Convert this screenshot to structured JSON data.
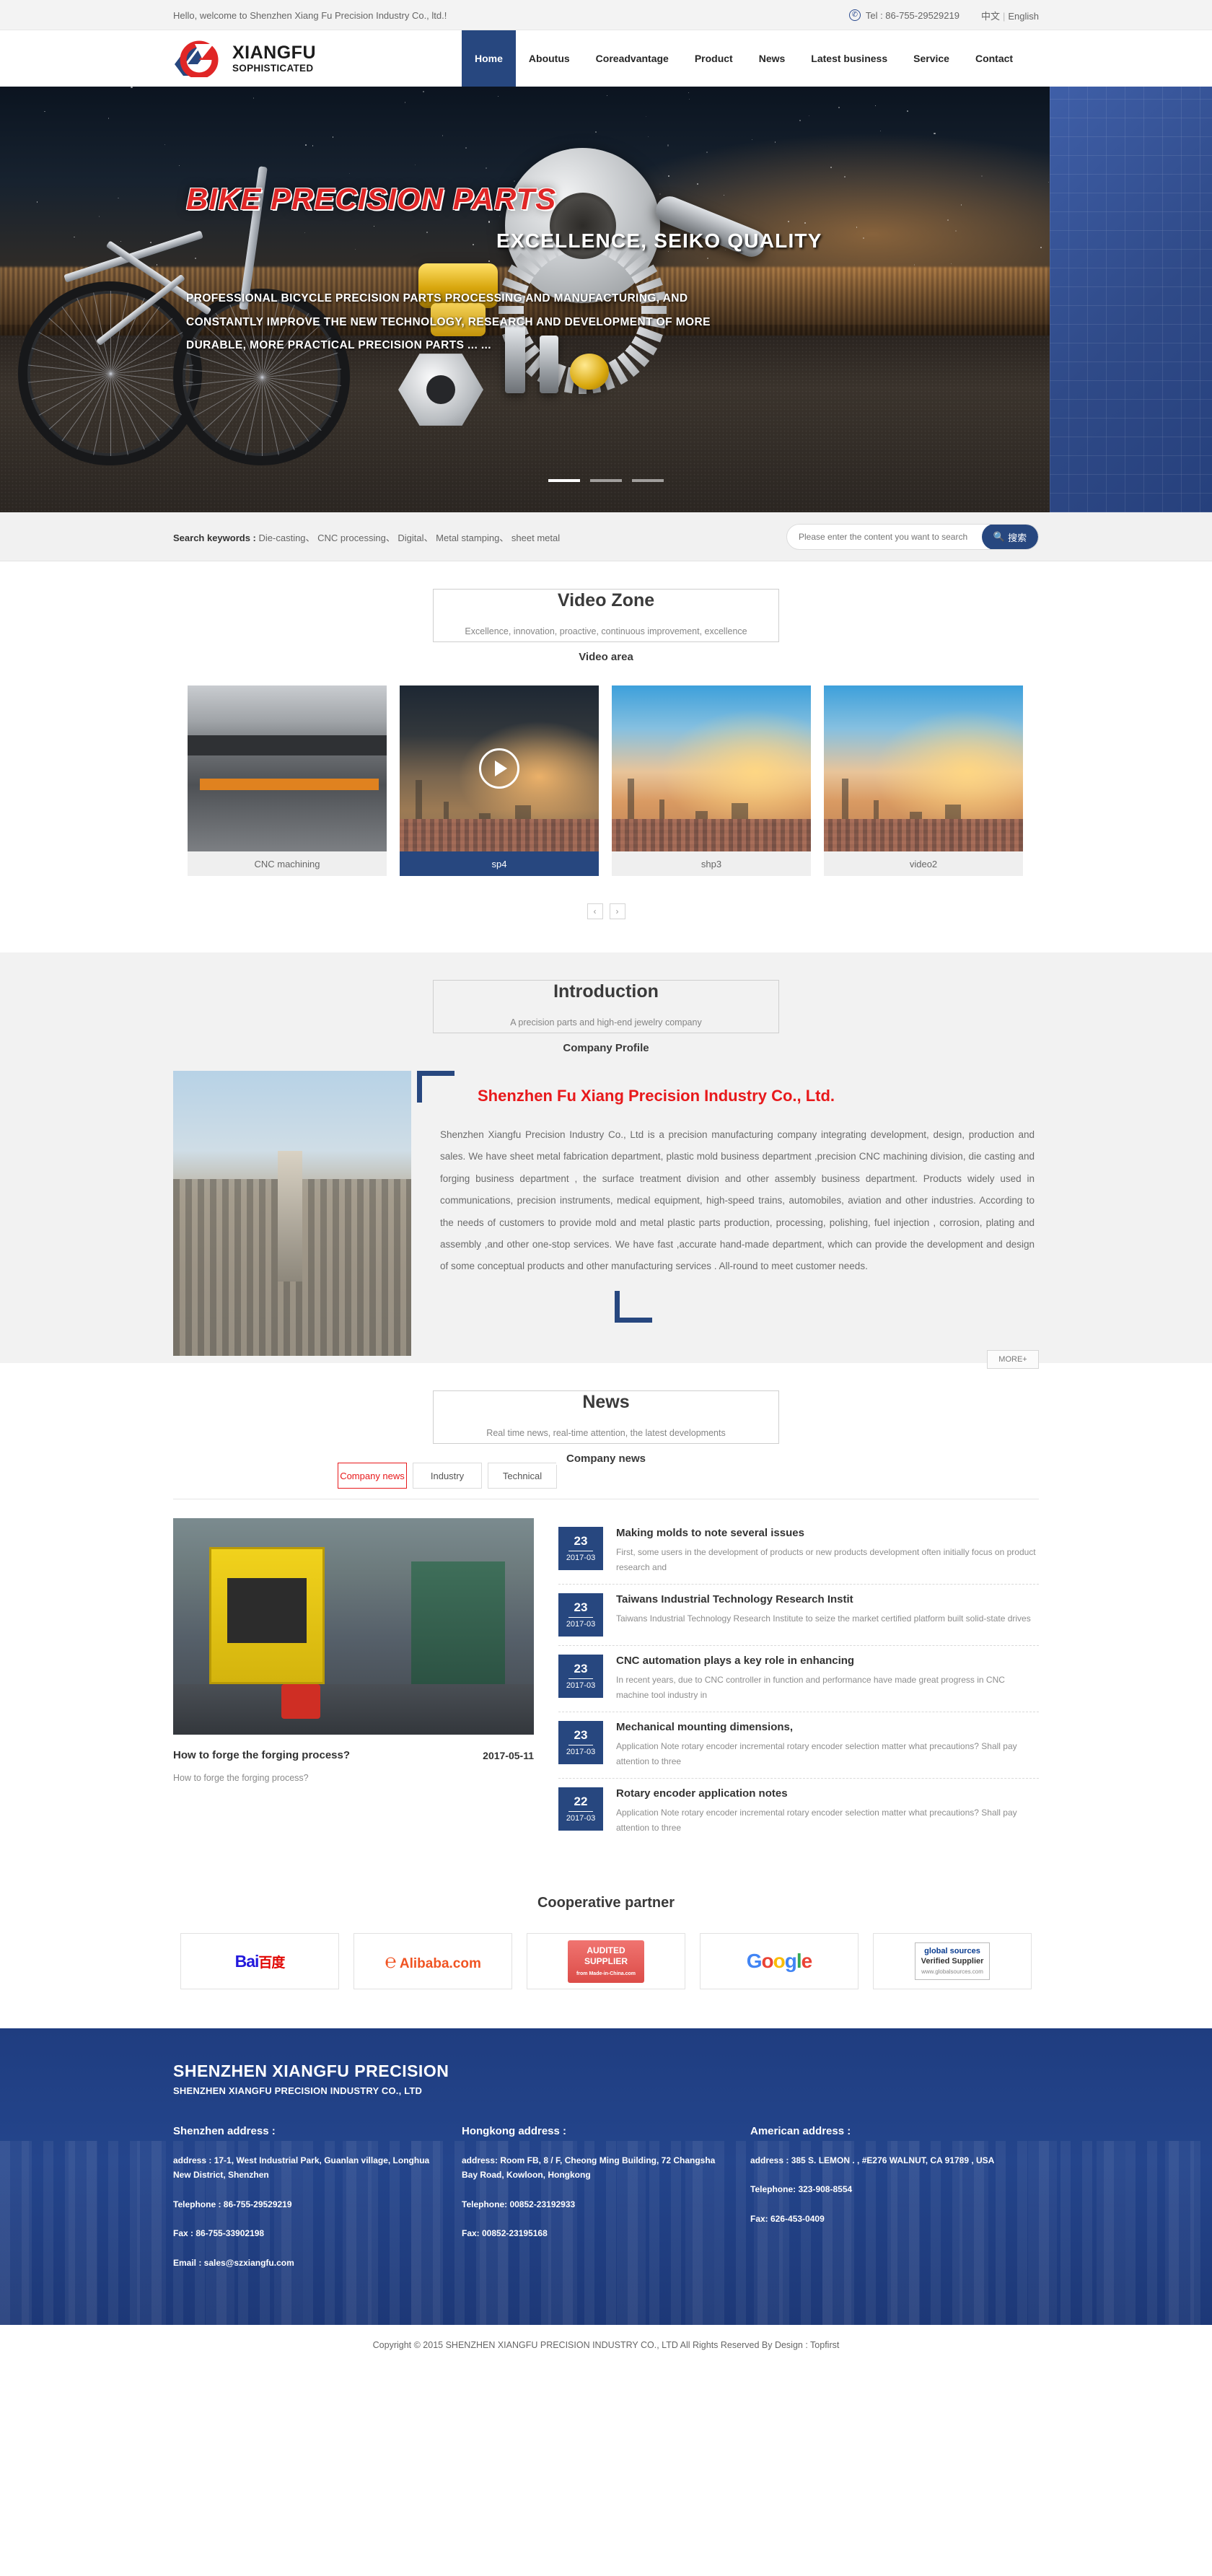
{
  "topbar": {
    "welcome": "Hello, welcome to Shenzhen Xiang Fu Precision Industry Co., ltd.!",
    "tel": "Tel : 86-755-29529219",
    "lang_cn": "中文",
    "lang_sep": "|",
    "lang_en": "English"
  },
  "header": {
    "logo_line1": "XIANGFU",
    "logo_line2": "SOPHISTICATED",
    "nav": [
      {
        "label": "Home",
        "active": true
      },
      {
        "label": "Aboutus",
        "active": false
      },
      {
        "label": "Coreadvantage",
        "active": false
      },
      {
        "label": "Product",
        "active": false
      },
      {
        "label": "News",
        "active": false
      },
      {
        "label": "Latest business",
        "active": false
      },
      {
        "label": "Service",
        "active": false
      },
      {
        "label": "Contact",
        "active": false
      }
    ]
  },
  "banner": {
    "title": "BIKE PRECISION PARTS",
    "subtitle": "EXCELLENCE, SEIKO QUALITY",
    "description": "PROFESSIONAL BICYCLE PRECISION PARTS PROCESSING AND MANUFACTURING, AND CONSTANTLY IMPROVE THE NEW TECHNOLOGY, RESEARCH AND DEVELOPMENT OF MORE DURABLE, MORE PRACTICAL PRECISION PARTS ... ...",
    "slides": 3,
    "active_slide": 1
  },
  "search": {
    "label": "Search keywords :",
    "keywords": "Die-casting、 CNC processing、 Digital、 Metal stamping、 sheet metal",
    "placeholder": "Please enter the content you want to search",
    "value": "",
    "button_label": "搜索"
  },
  "video_zone": {
    "title": "Video Zone",
    "subtitle": "Excellence, innovation, proactive, continuous improvement, excellence",
    "heading2": "Video area",
    "items": [
      {
        "label": "CNC machining",
        "active": false,
        "has_play": false
      },
      {
        "label": "sp4",
        "active": true,
        "has_play": true
      },
      {
        "label": "shp3",
        "active": false,
        "has_play": false
      },
      {
        "label": "video2",
        "active": false,
        "has_play": false
      }
    ],
    "prev_label": "‹",
    "next_label": "›"
  },
  "introduction": {
    "title": "Introduction",
    "subtitle": "A precision parts and high-end jewelry company",
    "heading2": "Company Profile",
    "company_name": "Shenzhen Fu Xiang Precision Industry Co., Ltd.",
    "body": "Shenzhen Xiangfu Precision Industry Co., Ltd is a precision manufacturing company integrating development, design, production and sales. We have sheet metal fabrication department, plastic mold business department ,precision CNC machining division, die casting and forging business department , the surface treatment division and other assembly business department. Products widely used in communications, precision instruments, medical equipment, high-speed trains, automobiles, aviation and other industries. According to the needs of customers to provide mold and metal plastic parts production, processing, polishing, fuel injection , corrosion, plating and assembly ,and other one-stop services. We have fast ,accurate hand-made department, which can provide the development and design of some conceptual products and other manufacturing services . All-round to meet customer needs.",
    "more_label": "MORE+"
  },
  "news": {
    "title": "News",
    "subtitle": "Real time news, real-time attention, the latest developments",
    "heading2": "Company news",
    "tabs": [
      {
        "label": "Company news",
        "active": true
      },
      {
        "label": "Industry",
        "active": false
      },
      {
        "label": "Technical",
        "active": false
      }
    ],
    "featured": {
      "title": "How to forge the forging process?",
      "date": "2017-05-11",
      "desc": "How to forge the forging process?"
    },
    "items": [
      {
        "day": "23",
        "month": "2017-03",
        "title": "Making molds to note several issues",
        "desc": "First, some users in the development of products or new products development often initially focus on product research and"
      },
      {
        "day": "23",
        "month": "2017-03",
        "title": "Taiwans Industrial Technology Research Instit",
        "desc": "Taiwans Industrial Technology Research Institute to seize the market certified platform built solid-state drives"
      },
      {
        "day": "23",
        "month": "2017-03",
        "title": "CNC automation plays a key role in enhancing",
        "desc": "In recent years, due to CNC controller in function and performance have made great progress in CNC machine tool industry in"
      },
      {
        "day": "23",
        "month": "2017-03",
        "title": "Mechanical mounting dimensions,",
        "desc": "Application Note rotary encoder incremental rotary encoder selection matter what precautions? Shall pay attention to three"
      },
      {
        "day": "22",
        "month": "2017-03",
        "title": "Rotary encoder application notes",
        "desc": "Application Note rotary encoder incremental rotary encoder selection matter what precautions? Shall pay attention to three"
      }
    ]
  },
  "partners": {
    "title": "Cooperative partner",
    "items": [
      {
        "name": "Bai",
        "name2": "百度",
        "kind": "baidu"
      },
      {
        "name": "Alibaba.com",
        "kind": "alibaba"
      },
      {
        "line1": "AUDITED",
        "line2": "SUPPLIER",
        "line3": "from Made-in-China.com",
        "kind": "audited"
      },
      {
        "name": "Google",
        "kind": "google"
      },
      {
        "line1": "global sources",
        "line2": "Verified Supplier",
        "line3": "www.globalsources.com",
        "kind": "gsources"
      }
    ]
  },
  "footer": {
    "brand": "SHENZHEN XIANGFU PRECISION",
    "brand_sub": "SHENZHEN XIANGFU PRECISION INDUSTRY CO., LTD",
    "columns": [
      {
        "heading": "Shenzhen address :",
        "address": "address : 17-1, West Industrial Park, Guanlan village, Longhua New District, Shenzhen",
        "telephone": "Telephone : 86-755-29529219",
        "fax": "Fax : 86-755-33902198",
        "email": "Email : sales@szxiangfu.com"
      },
      {
        "heading": "Hongkong address :",
        "address": "address: Room FB, 8 / F, Cheong Ming Building, 72 Changsha Bay Road, Kowloon, Hongkong",
        "telephone": "Telephone: 00852-23192933",
        "fax": "Fax: 00852-23195168",
        "email": ""
      },
      {
        "heading": "American address :",
        "address": "address : 385 S. LEMON . , #E276 WALNUT, CA 91789 , USA",
        "telephone": "Telephone: 323-908-8554",
        "fax": "Fax: 626-453-0409",
        "email": ""
      }
    ],
    "copyright": "Copyright © 2015 SHENZHEN XIANGFU PRECISION INDUSTRY CO., LTD All Rights Reserved By Design : Topfirst"
  },
  "colors": {
    "brand_blue": "#27477f",
    "brand_red": "#e8191b",
    "gray_bg": "#f2f2f2"
  }
}
